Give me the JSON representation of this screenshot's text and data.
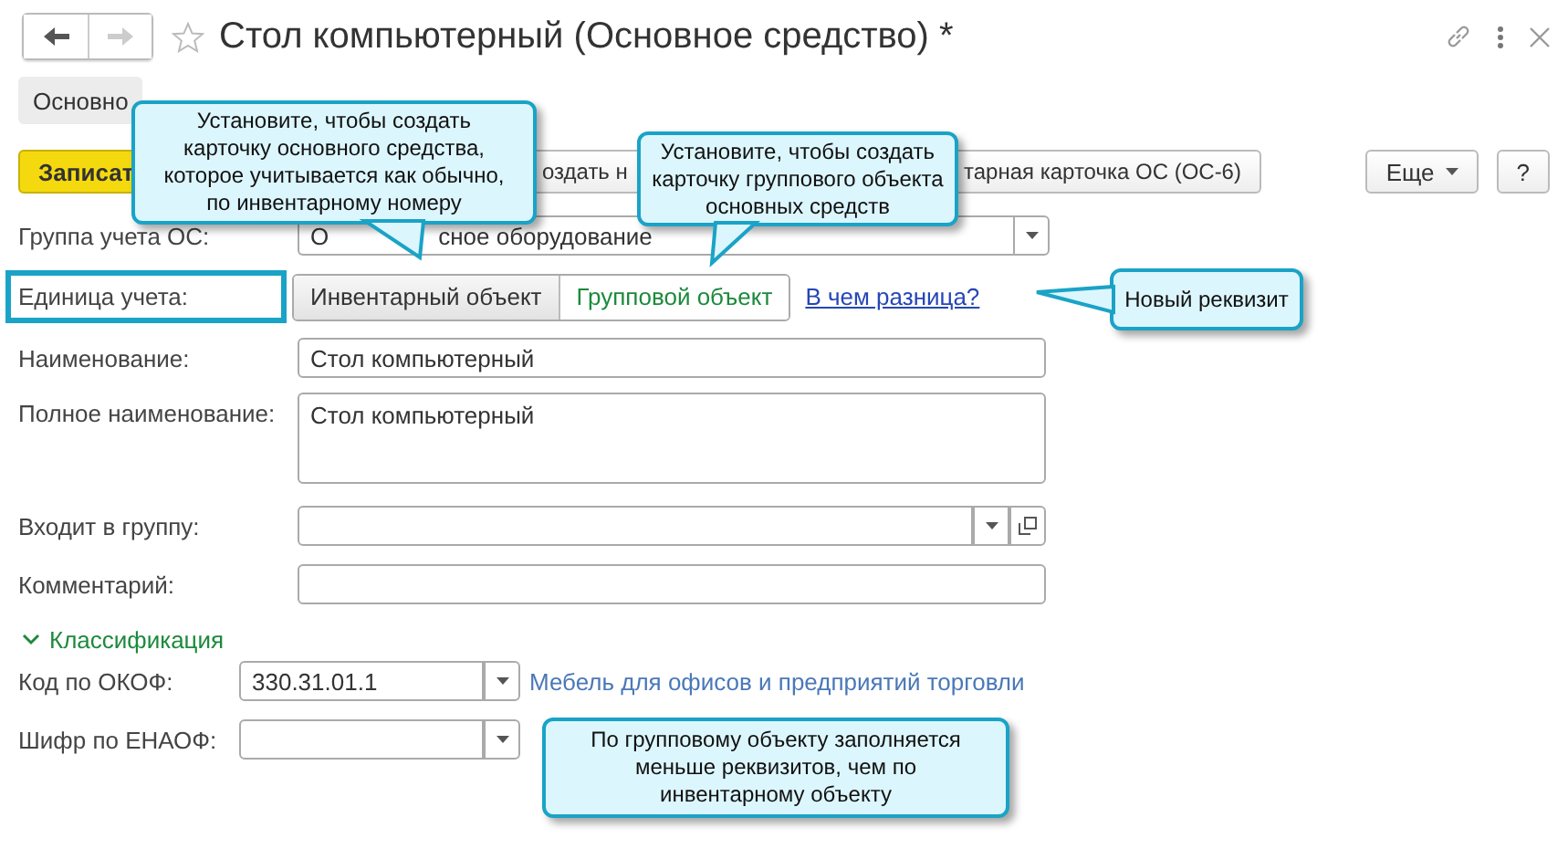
{
  "window": {
    "title": "Стол компьютерный (Основное средство) *"
  },
  "tabs": [
    {
      "label": "Основно",
      "selected": true
    }
  ],
  "toolbar": [
    {
      "label": "Записат",
      "kind": "primary"
    },
    {
      "label": "оздать н",
      "kind": "default"
    },
    {
      "label": "тарная карточка ОС (ОС-6)",
      "kind": "default"
    }
  ],
  "toolbar_right": [
    {
      "label": "Еще",
      "kind": "menu"
    },
    {
      "label": "?",
      "kind": "default"
    }
  ],
  "group": {
    "label": "Группа учета ОС:",
    "value_parts": [
      "О",
      "сное оборудование"
    ]
  },
  "unit": {
    "label": "Единица учета:",
    "highlighted": true,
    "options": [
      {
        "label": "Инвентарный объект",
        "selected": true
      },
      {
        "label": "Групповой объект",
        "selected": false
      }
    ],
    "link": "В чем разница?"
  },
  "name": {
    "label": "Наименование:",
    "value": "Стол компьютерный"
  },
  "full_name": {
    "label": "Полное наименование:",
    "value": "Стол компьютерный"
  },
  "parent_group": {
    "label": "Входит в группу:"
  },
  "comment": {
    "label": "Комментарий:"
  },
  "classification": {
    "title": "Классификация",
    "expanded": true,
    "okof": {
      "label": "Код по ОКОФ:",
      "value": "330.31.01.1",
      "description": "Мебель для офисов и предприятий торговли"
    },
    "enaof": {
      "label": "Шифр по ЕНАОФ:"
    }
  },
  "callouts": [
    "Установите, чтобы создать карточку основного средства, которое учитывается как обычно, по инвентарному номеру",
    "Установите, чтобы создать карточку группового объекта основных средств",
    "Новый реквизит",
    "По групповому объекту заполняется меньше реквизитов, чем по инвентарному объекту"
  ]
}
